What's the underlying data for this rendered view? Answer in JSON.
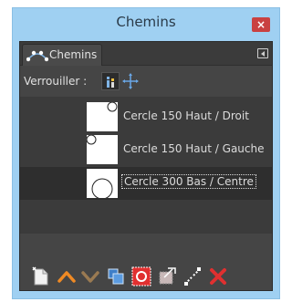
{
  "window": {
    "title": "Chemins",
    "close_glyph": "×"
  },
  "tab": {
    "label": "Chemins",
    "icon": "paths-icon"
  },
  "lock": {
    "label": "Verrouiller :",
    "buttons": [
      "lock-pixels-icon",
      "lock-position-icon"
    ]
  },
  "paths": [
    {
      "label": "Cercle 150  Haut / Droit",
      "selected": false
    },
    {
      "label": "Cercle 150 Haut / Gauche",
      "selected": false
    },
    {
      "label": "Cercle 300 Bas / Centre",
      "selected": true
    }
  ],
  "toolbar": [
    "new-path-icon",
    "raise-path-icon",
    "lower-path-icon",
    "duplicate-path-icon",
    "path-to-selection-icon",
    "selection-to-path-icon",
    "stroke-path-icon",
    "delete-path-icon"
  ],
  "colors": {
    "accent_orange": "#f08a24",
    "delete_red": "#e03030",
    "close_red": "#c94141",
    "titlebar_blue": "#9fd0f2"
  }
}
